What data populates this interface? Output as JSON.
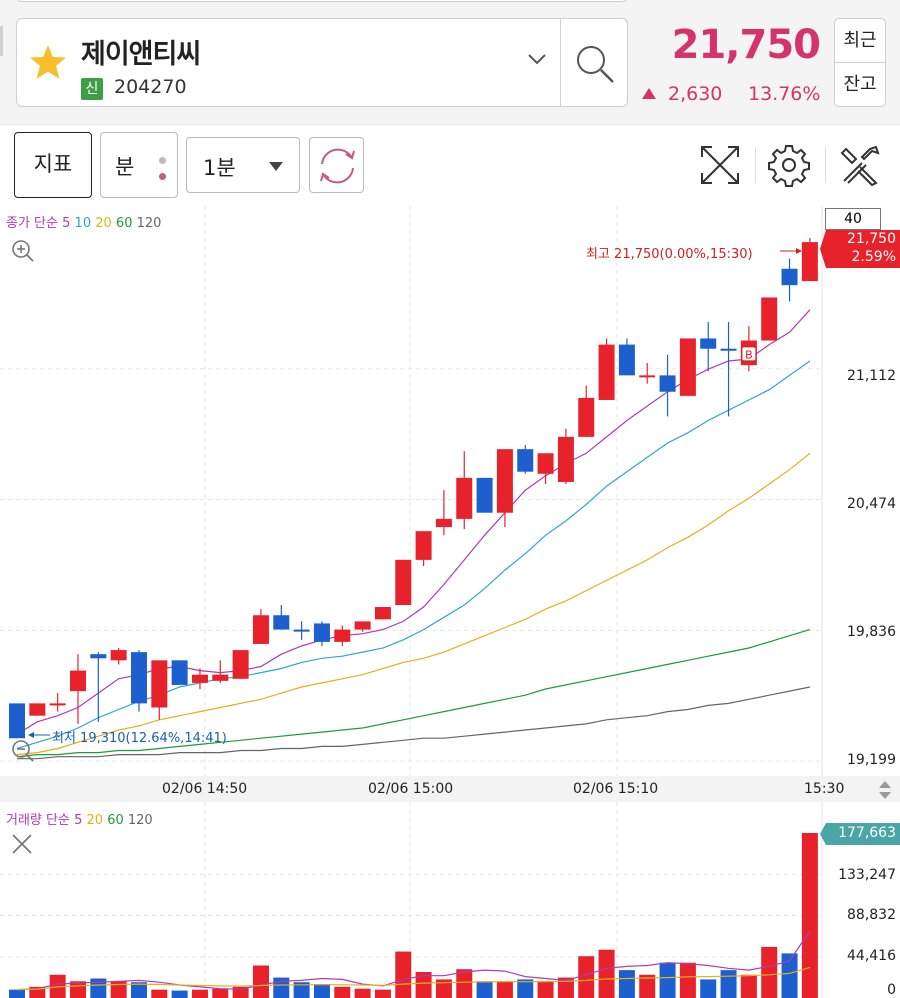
{
  "header": {
    "stock_name": "제이앤티씨",
    "credit_badge": "신",
    "stock_code": "204270",
    "price": "21,750",
    "change": "2,630",
    "change_pct": "13.76%",
    "btn_recent": "최근",
    "btn_balance": "잔고",
    "price_color": "#d5336b"
  },
  "toolbar": {
    "indicator": "지표",
    "interval_type": "분",
    "interval_value": "1분",
    "icons": [
      "expand-icon",
      "gear-icon",
      "tools-icon",
      "refresh-icon"
    ]
  },
  "price_chart": {
    "legend": {
      "prefix": "종가 단순",
      "ma": [
        {
          "period": "5",
          "color": "#b03ab8"
        },
        {
          "period": "10",
          "color": "#2aa9c9"
        },
        {
          "period": "20",
          "color": "#e0b21a"
        },
        {
          "period": "60",
          "color": "#1e9b3a"
        },
        {
          "period": "120",
          "color": "#666666"
        }
      ]
    },
    "top_box": "40",
    "current_price_tag": "21,750",
    "current_pct_tag": "2.59%",
    "high_label": "최고 21,750(0.00%,15:30)",
    "low_label": "최저 19,310(12.64%,14:41)",
    "y_ticks": [
      "21,112",
      "20,474",
      "19,836",
      "19,199"
    ],
    "x_ticks": [
      "02/06 14:50",
      "02/06 15:00",
      "02/06 15:10",
      "15:30"
    ]
  },
  "volume_chart": {
    "legend": {
      "prefix": "거래량 단순",
      "ma": [
        {
          "period": "5",
          "color": "#b03ab8"
        },
        {
          "period": "20",
          "color": "#e0b21a"
        },
        {
          "period": "60",
          "color": "#1e9b3a"
        },
        {
          "period": "120",
          "color": "#666666"
        }
      ]
    },
    "current_tag": "177,663",
    "y_ticks": [
      "133,247",
      "88,832",
      "44,416",
      "0"
    ]
  },
  "chart_data": {
    "type": "candlestick",
    "interval": "1분",
    "ylim": [
      19199,
      21750
    ],
    "x_labels": [
      "02/06 14:50",
      "02/06 15:00",
      "02/06 15:10",
      "15:30"
    ],
    "candles": [
      {
        "o": 19480,
        "h": 19480,
        "l": 19310,
        "c": 19310
      },
      {
        "o": 19420,
        "h": 19480,
        "l": 19420,
        "c": 19480
      },
      {
        "o": 19470,
        "h": 19530,
        "l": 19440,
        "c": 19480
      },
      {
        "o": 19540,
        "h": 19720,
        "l": 19380,
        "c": 19640
      },
      {
        "o": 19720,
        "h": 19730,
        "l": 19390,
        "c": 19700
      },
      {
        "o": 19690,
        "h": 19750,
        "l": 19670,
        "c": 19740
      },
      {
        "o": 19730,
        "h": 19740,
        "l": 19440,
        "c": 19480
      },
      {
        "o": 19460,
        "h": 19500,
        "l": 19400,
        "c": 19690
      },
      {
        "o": 19690,
        "h": 19690,
        "l": 19580,
        "c": 19570
      },
      {
        "o": 19580,
        "h": 19650,
        "l": 19550,
        "c": 19620
      },
      {
        "o": 19590,
        "h": 19690,
        "l": 19580,
        "c": 19620
      },
      {
        "o": 19600,
        "h": 19720,
        "l": 19600,
        "c": 19740
      },
      {
        "o": 19770,
        "h": 19940,
        "l": 19770,
        "c": 19910
      },
      {
        "o": 19910,
        "h": 19960,
        "l": 19840,
        "c": 19840
      },
      {
        "o": 19840,
        "h": 19880,
        "l": 19790,
        "c": 19830
      },
      {
        "o": 19870,
        "h": 19880,
        "l": 19760,
        "c": 19780
      },
      {
        "o": 19780,
        "h": 19860,
        "l": 19760,
        "c": 19840
      },
      {
        "o": 19840,
        "h": 19880,
        "l": 19830,
        "c": 19880
      },
      {
        "o": 19890,
        "h": 19950,
        "l": 19890,
        "c": 19950
      },
      {
        "o": 19960,
        "h": 20080,
        "l": 19960,
        "c": 20180
      },
      {
        "o": 20180,
        "h": 20320,
        "l": 20150,
        "c": 20320
      },
      {
        "o": 20340,
        "h": 20520,
        "l": 20300,
        "c": 20380
      },
      {
        "o": 20380,
        "h": 20710,
        "l": 20330,
        "c": 20580
      },
      {
        "o": 20580,
        "h": 20580,
        "l": 20440,
        "c": 20410
      },
      {
        "o": 20410,
        "h": 20720,
        "l": 20340,
        "c": 20720
      },
      {
        "o": 20720,
        "h": 20740,
        "l": 20600,
        "c": 20610
      },
      {
        "o": 20600,
        "h": 20700,
        "l": 20550,
        "c": 20700
      },
      {
        "o": 20560,
        "h": 20820,
        "l": 20550,
        "c": 20780
      },
      {
        "o": 20780,
        "h": 21030,
        "l": 20780,
        "c": 20970
      },
      {
        "o": 20960,
        "h": 21260,
        "l": 20960,
        "c": 21230
      },
      {
        "o": 21230,
        "h": 21260,
        "l": 21080,
        "c": 21080
      },
      {
        "o": 21080,
        "h": 21140,
        "l": 21040,
        "c": 21080
      },
      {
        "o": 21080,
        "h": 21180,
        "l": 20880,
        "c": 21000
      },
      {
        "o": 20980,
        "h": 21260,
        "l": 20980,
        "c": 21260
      },
      {
        "o": 21260,
        "h": 21340,
        "l": 21100,
        "c": 21210
      },
      {
        "o": 21210,
        "h": 21340,
        "l": 20880,
        "c": 21200
      },
      {
        "o": 21130,
        "h": 21320,
        "l": 21100,
        "c": 21250
      },
      {
        "o": 21250,
        "h": 21460,
        "l": 21250,
        "c": 21460
      },
      {
        "o": 21600,
        "h": 21650,
        "l": 21440,
        "c": 21520
      },
      {
        "o": 21540,
        "h": 21750,
        "l": 21540,
        "c": 21730
      }
    ],
    "ma": {
      "5": [
        19330,
        19390,
        19420,
        19460,
        19530,
        19600,
        19620,
        19650,
        19660,
        19640,
        19630,
        19640,
        19660,
        19720,
        19760,
        19790,
        19810,
        19820,
        19840,
        19880,
        19950,
        20060,
        20180,
        20300,
        20410,
        20520,
        20590,
        20650,
        20700,
        20780,
        20860,
        20930,
        21000,
        21060,
        21110,
        21150,
        21160,
        21230,
        21290,
        21400
      ],
      "10": [
        19260,
        19290,
        19320,
        19360,
        19410,
        19450,
        19490,
        19520,
        19560,
        19580,
        19600,
        19610,
        19630,
        19650,
        19680,
        19700,
        19710,
        19730,
        19750,
        19790,
        19840,
        19900,
        19960,
        20040,
        20130,
        20210,
        20300,
        20370,
        20450,
        20540,
        20610,
        20680,
        20750,
        20800,
        20860,
        20910,
        20960,
        21010,
        21080,
        21150
      ],
      "20": [
        19230,
        19240,
        19260,
        19290,
        19320,
        19350,
        19370,
        19400,
        19420,
        19440,
        19460,
        19480,
        19500,
        19530,
        19560,
        19580,
        19600,
        19620,
        19650,
        19680,
        19700,
        19730,
        19770,
        19810,
        19850,
        19890,
        19940,
        19980,
        20030,
        20080,
        20130,
        20180,
        20240,
        20290,
        20350,
        20420,
        20480,
        20550,
        20620,
        20700
      ],
      "60": [
        19220,
        19230,
        19230,
        19240,
        19240,
        19250,
        19250,
        19260,
        19270,
        19280,
        19290,
        19300,
        19310,
        19320,
        19330,
        19340,
        19350,
        19360,
        19380,
        19400,
        19420,
        19440,
        19460,
        19480,
        19500,
        19520,
        19550,
        19570,
        19590,
        19610,
        19630,
        19650,
        19670,
        19690,
        19710,
        19730,
        19750,
        19780,
        19810,
        19840
      ],
      "120": [
        19210,
        19210,
        19220,
        19220,
        19220,
        19230,
        19230,
        19230,
        19240,
        19240,
        19240,
        19250,
        19250,
        19260,
        19260,
        19270,
        19270,
        19280,
        19290,
        19300,
        19310,
        19310,
        19320,
        19330,
        19340,
        19350,
        19360,
        19370,
        19380,
        19400,
        19410,
        19420,
        19440,
        19450,
        19470,
        19480,
        19500,
        19520,
        19540,
        19560
      ]
    },
    "volume": {
      "ylim": [
        0,
        177663
      ],
      "values": [
        9000,
        12000,
        25000,
        18000,
        21000,
        18000,
        17000,
        9000,
        8000,
        9000,
        10000,
        12000,
        35000,
        22000,
        17000,
        15000,
        12000,
        10000,
        9000,
        50000,
        28000,
        20000,
        31000,
        18000,
        18000,
        20000,
        18000,
        22000,
        45000,
        52000,
        30000,
        25000,
        38000,
        38000,
        20000,
        30000,
        25000,
        55000,
        48000,
        177663
      ],
      "ma5": [
        9000,
        10000,
        15000,
        16000,
        17000,
        18000,
        19000,
        17000,
        14000,
        12000,
        10000,
        9500,
        14000,
        18000,
        19000,
        21000,
        20000,
        15000,
        13000,
        20000,
        24000,
        24000,
        28000,
        30000,
        29000,
        23000,
        21000,
        19000,
        25000,
        32000,
        34000,
        35000,
        38000,
        37000,
        35000,
        32000,
        30000,
        34000,
        40000,
        72000
      ],
      "ma20": [
        9000,
        9500,
        12000,
        13000,
        14000,
        14500,
        15000,
        14500,
        14000,
        13500,
        13000,
        12800,
        13500,
        14000,
        14200,
        14300,
        14200,
        14000,
        13700,
        15000,
        16000,
        16500,
        17000,
        17300,
        17500,
        17600,
        17700,
        18000,
        19000,
        20500,
        21000,
        21500,
        22000,
        22800,
        23000,
        23500,
        24000,
        25000,
        26500,
        33000
      ]
    }
  }
}
